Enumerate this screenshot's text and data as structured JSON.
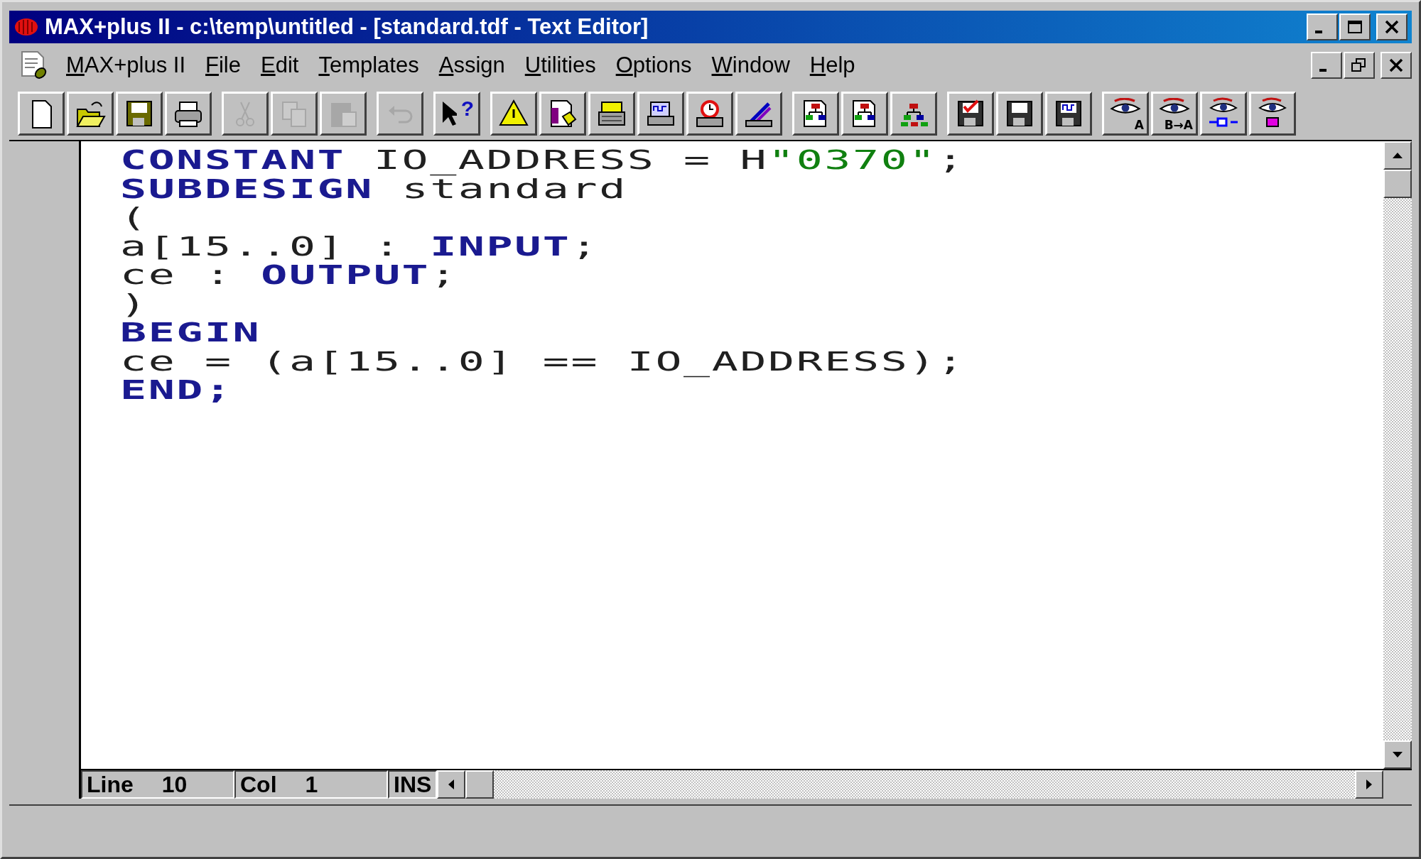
{
  "window": {
    "title": "MAX+plus II - c:\\temp\\untitled - [standard.tdf - Text Editor]"
  },
  "menu": [
    {
      "mnemonic": "M",
      "rest": "AX+plus II"
    },
    {
      "mnemonic": "F",
      "rest": "ile"
    },
    {
      "mnemonic": "E",
      "rest": "dit"
    },
    {
      "mnemonic": "T",
      "rest": "emplates"
    },
    {
      "mnemonic": "A",
      "rest": "ssign"
    },
    {
      "mnemonic": "U",
      "rest": "tilities"
    },
    {
      "mnemonic": "O",
      "rest": "ptions"
    },
    {
      "mnemonic": "W",
      "rest": "indow"
    },
    {
      "mnemonic": "H",
      "rest": "elp"
    }
  ],
  "toolbar": [
    [
      {
        "kind": "new",
        "disabled": false
      },
      {
        "kind": "open",
        "disabled": false
      },
      {
        "kind": "save",
        "disabled": false
      },
      {
        "kind": "print",
        "disabled": false
      }
    ],
    [
      {
        "kind": "cut",
        "disabled": true
      },
      {
        "kind": "copy",
        "disabled": true
      },
      {
        "kind": "paste",
        "disabled": true
      }
    ],
    [
      {
        "kind": "undo",
        "disabled": true
      }
    ],
    [
      {
        "kind": "help",
        "badge": "?",
        "disabled": false
      }
    ],
    [
      {
        "kind": "warning",
        "disabled": false
      },
      {
        "kind": "tag",
        "disabled": false
      },
      {
        "kind": "form",
        "disabled": false
      },
      {
        "kind": "chip",
        "disabled": false
      },
      {
        "kind": "timer",
        "disabled": false
      },
      {
        "kind": "bars",
        "disabled": false
      }
    ],
    [
      {
        "kind": "hierarchy",
        "disabled": false
      },
      {
        "kind": "hierarchy",
        "disabled": false
      },
      {
        "kind": "tree",
        "disabled": false
      }
    ],
    [
      {
        "kind": "checkdisk",
        "disabled": false
      },
      {
        "kind": "disk",
        "disabled": false
      },
      {
        "kind": "wavedisk",
        "disabled": false
      }
    ],
    [
      {
        "kind": "eye",
        "badge": "A",
        "disabled": false
      },
      {
        "kind": "eye",
        "badge": "B→A",
        "disabled": false
      },
      {
        "kind": "eyewire",
        "disabled": false
      },
      {
        "kind": "eyechip",
        "disabled": false
      }
    ]
  ],
  "editor": {
    "lines": [
      [
        {
          "kind": "keyword",
          "text": "CONSTANT"
        },
        {
          "kind": "plain",
          "text": " IO_ADDRESS = H"
        },
        {
          "kind": "string",
          "text": "\"0370\""
        },
        {
          "kind": "plain",
          "text": ";"
        }
      ],
      [
        {
          "kind": "keyword",
          "text": "SUBDESIGN"
        },
        {
          "kind": "plain",
          "text": " standard"
        }
      ],
      [
        {
          "kind": "plain",
          "text": "("
        }
      ],
      [
        {
          "kind": "plain",
          "text": "a[15..0] : "
        },
        {
          "kind": "keyword",
          "text": "INPUT"
        },
        {
          "kind": "plain",
          "text": ";"
        }
      ],
      [
        {
          "kind": "plain",
          "text": "ce : "
        },
        {
          "kind": "keyword",
          "text": "OUTPUT"
        },
        {
          "kind": "plain",
          "text": ";"
        }
      ],
      [
        {
          "kind": "plain",
          "text": ")"
        }
      ],
      [
        {
          "kind": "keyword",
          "text": "BEGIN"
        }
      ],
      [
        {
          "kind": "plain",
          "text": "ce = (a[15..0] == IO_ADDRESS);"
        }
      ],
      [
        {
          "kind": "keyword",
          "text": "END;"
        }
      ]
    ]
  },
  "editor_status": {
    "line_label": "Line",
    "line": "10",
    "col_label": "Col",
    "col": "1",
    "mode": "INS"
  }
}
